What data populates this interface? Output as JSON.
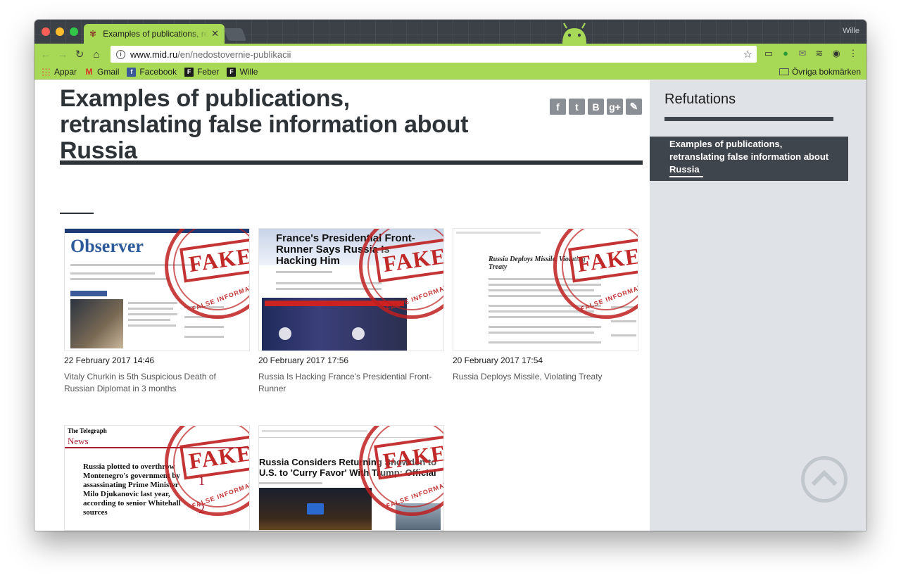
{
  "browser": {
    "tab_title": "Examples of publications, retranslating",
    "tab_close": "✕",
    "profile_name": "Wille",
    "url_host": "www.mid.ru",
    "url_path": "/en/nedostovernie-publikacii",
    "bookmarks": [
      {
        "label": "Appar",
        "icon": "apps-icon"
      },
      {
        "label": "Gmail",
        "icon": "gmail-icon"
      },
      {
        "label": "Facebook",
        "icon": "facebook-icon"
      },
      {
        "label": "Feber",
        "icon": "feber-icon"
      },
      {
        "label": "Wille",
        "icon": "feber-icon"
      }
    ],
    "other_bookmarks": "Övriga bokmärken"
  },
  "page": {
    "title": "Examples of publications, retranslating false information about Russia",
    "share_buttons": [
      "f",
      "t",
      "B",
      "g+",
      "✎"
    ],
    "stamp_word": "FAKE",
    "stamp_arc": "FALSE INFORMATION",
    "cards": [
      {
        "date": "22 February 2017 14:46",
        "title": "Vitaly Churkin is 5th Suspicious Death of Russian Diplomat in 3 months",
        "thumb_headline": "Observer"
      },
      {
        "date": "20 February 2017 17:56",
        "title": "Russia Is Hacking France's Presidential Front-Runner",
        "thumb_headline": "France's Presidential Front-Runner Says Russia Is Hacking Him"
      },
      {
        "date": "20 February 2017 17:54",
        "title": "Russia Deploys Missile, Violating Treaty",
        "thumb_headline": "Russia Deploys Missile, Violating Treaty"
      },
      {
        "date": "",
        "title": "",
        "thumb_headline": "Russia plotted to overthrow Montenegro's government by assassinating Prime Minister Milo Djukanovic last year, according to senior Whitehall sources"
      },
      {
        "date": "",
        "title": "",
        "thumb_headline": "Russia Considers Returning Snowden to U.S. to 'Curry Favor' With Trump: Official"
      }
    ]
  },
  "sidebar": {
    "title": "Refutations",
    "items": [
      {
        "label": "Examples of publications, retranslating false information about Russia",
        "active": true
      }
    ]
  },
  "colors": {
    "chrome_green": "#a8d956",
    "title_dark": "#2e3338",
    "sidebar_bg": "#dfe3e7",
    "sidebar_active": "#3f454c",
    "stamp_red": "#be1e1e"
  }
}
